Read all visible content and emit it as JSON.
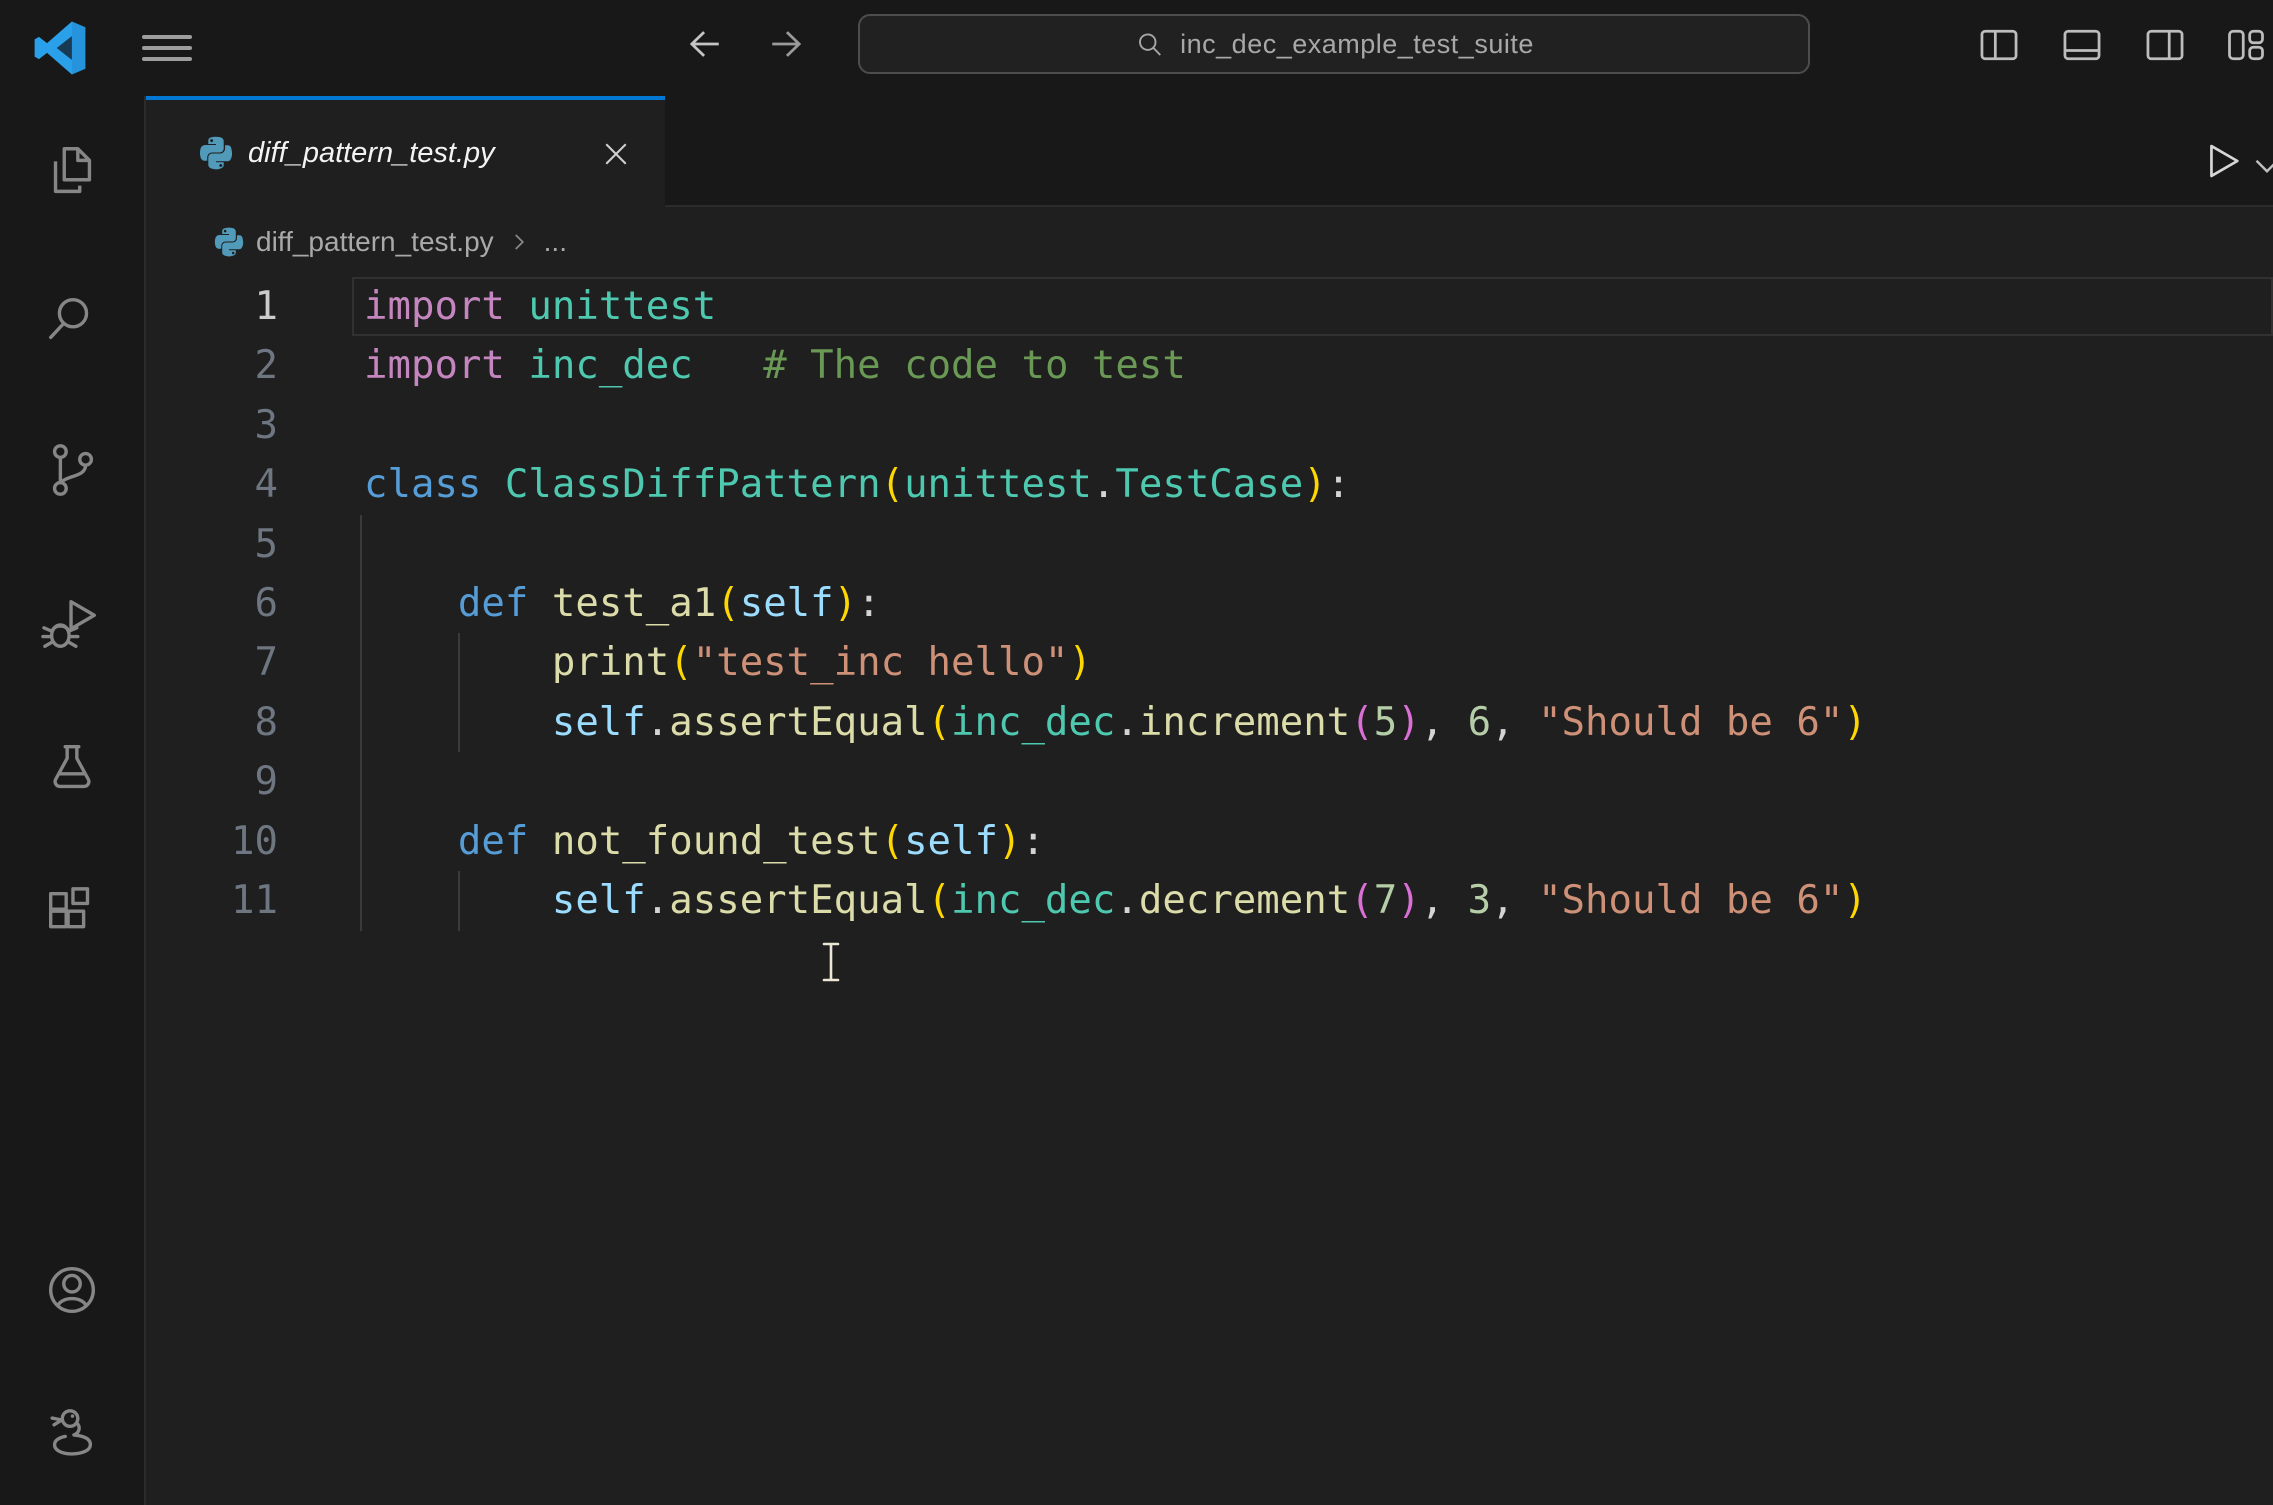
{
  "titlebar": {
    "search_value": "inc_dec_example_test_suite"
  },
  "tab": {
    "label": "diff_pattern_test.py",
    "state": "preview-italic",
    "modified": false
  },
  "breadcrumb": {
    "file": "diff_pattern_test.py",
    "more": "..."
  },
  "activity_bar": {
    "items": [
      "explorer",
      "search",
      "source-control",
      "run-and-debug",
      "testing",
      "extensions"
    ],
    "bottom_items": [
      "accounts",
      "python-environments"
    ]
  },
  "editor": {
    "language": "python",
    "cursor_line": 1,
    "lines": [
      {
        "n": "1",
        "active": true,
        "segs": [
          [
            "import",
            "kwi"
          ],
          [
            " ",
            "pl"
          ],
          [
            "unittest",
            "ty"
          ]
        ]
      },
      {
        "n": "2",
        "segs": [
          [
            "import",
            "kwi"
          ],
          [
            " ",
            "pl"
          ],
          [
            "inc_dec",
            "ty"
          ],
          [
            "   ",
            "pl"
          ],
          [
            "# The code to test",
            "co"
          ]
        ]
      },
      {
        "n": "3",
        "segs": []
      },
      {
        "n": "4",
        "segs": [
          [
            "class",
            "kw"
          ],
          [
            " ",
            "pl"
          ],
          [
            "ClassDiffPattern",
            "ty"
          ],
          [
            "(",
            "b1"
          ],
          [
            "unittest",
            "ty"
          ],
          [
            ".",
            "pl"
          ],
          [
            "TestCase",
            "ty"
          ],
          [
            ")",
            "b1"
          ],
          [
            ":",
            "pl"
          ]
        ]
      },
      {
        "n": "5",
        "segs": []
      },
      {
        "n": "6",
        "segs": [
          [
            "    ",
            "pl"
          ],
          [
            "def",
            "kw"
          ],
          [
            " ",
            "pl"
          ],
          [
            "test_a1",
            "fn"
          ],
          [
            "(",
            "b1"
          ],
          [
            "self",
            "pa"
          ],
          [
            ")",
            "b1"
          ],
          [
            ":",
            "pl"
          ]
        ]
      },
      {
        "n": "7",
        "segs": [
          [
            "        ",
            "pl"
          ],
          [
            "print",
            "fn"
          ],
          [
            "(",
            "b1"
          ],
          [
            "\"test_inc hello\"",
            "st"
          ],
          [
            ")",
            "b1"
          ]
        ]
      },
      {
        "n": "8",
        "segs": [
          [
            "        ",
            "pl"
          ],
          [
            "self",
            "pa"
          ],
          [
            ".",
            "pl"
          ],
          [
            "assertEqual",
            "fn"
          ],
          [
            "(",
            "b1"
          ],
          [
            "inc_dec",
            "ty"
          ],
          [
            ".",
            "pl"
          ],
          [
            "increment",
            "fn"
          ],
          [
            "(",
            "b2"
          ],
          [
            "5",
            "nu"
          ],
          [
            ")",
            "b2"
          ],
          [
            ", ",
            "pl"
          ],
          [
            "6",
            "nu"
          ],
          [
            ", ",
            "pl"
          ],
          [
            "\"Should be 6\"",
            "st"
          ],
          [
            ")",
            "b1"
          ]
        ]
      },
      {
        "n": "9",
        "segs": []
      },
      {
        "n": "10",
        "segs": [
          [
            "    ",
            "pl"
          ],
          [
            "def",
            "kw"
          ],
          [
            " ",
            "pl"
          ],
          [
            "not_found_test",
            "fn"
          ],
          [
            "(",
            "b1"
          ],
          [
            "self",
            "pa"
          ],
          [
            ")",
            "b1"
          ],
          [
            ":",
            "pl"
          ]
        ]
      },
      {
        "n": "11",
        "segs": [
          [
            "        ",
            "pl"
          ],
          [
            "self",
            "pa"
          ],
          [
            ".",
            "pl"
          ],
          [
            "assertEqual",
            "fn"
          ],
          [
            "(",
            "b1"
          ],
          [
            "inc_dec",
            "ty"
          ],
          [
            ".",
            "pl"
          ],
          [
            "decrement",
            "fn"
          ],
          [
            "(",
            "b2"
          ],
          [
            "7",
            "nu"
          ],
          [
            ")",
            "b2"
          ],
          [
            ", ",
            "pl"
          ],
          [
            "3",
            "nu"
          ],
          [
            ", ",
            "pl"
          ],
          [
            "\"Should be 6\"",
            "st"
          ],
          [
            ")",
            "b1"
          ]
        ]
      }
    ]
  },
  "colors": {
    "accent_blue": "#0078d4",
    "chrome_bg": "#181818",
    "editor_bg": "#1f1f1f",
    "border": "#2b2b2b",
    "python_icon_blue": "#519aba",
    "syntax": {
      "keyword_import": "#C586C0",
      "type": "#4EC9B0",
      "keyword": "#569CD6",
      "function": "#DCDCAA",
      "parameter": "#9CDCFE",
      "plain": "#D4D4D4",
      "bracket_level1": "#FFD700",
      "bracket_level2": "#DA70D6",
      "string": "#CE9178",
      "number": "#B5CEA8",
      "comment": "#6A9955"
    }
  }
}
